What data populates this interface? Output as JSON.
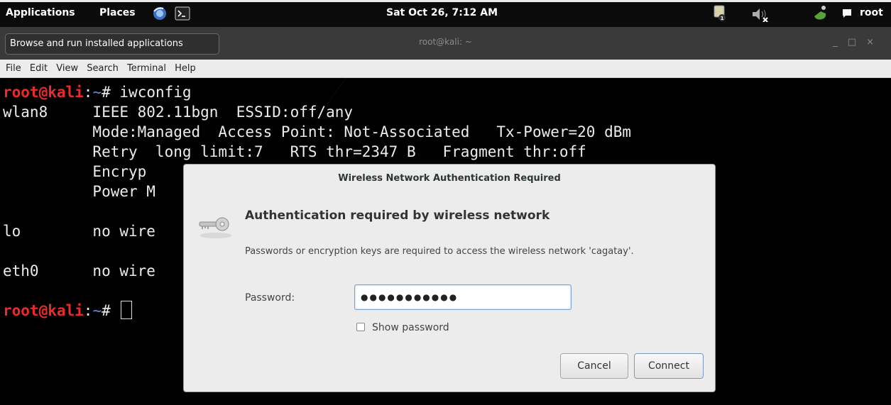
{
  "panel": {
    "applications": "Applications",
    "places": "Places",
    "clock": "Sat Oct 26,  7:12 AM",
    "user": "root"
  },
  "tooltip": {
    "text": "Browse and run installed applications"
  },
  "terminal": {
    "title": "root@kali: ~",
    "menu": [
      "File",
      "Edit",
      "View",
      "Search",
      "Terminal",
      "Help"
    ],
    "prompt_user": "root@kali",
    "prompt_sep": ":",
    "prompt_path": "~",
    "prompt_hash": "# ",
    "command": "iwconfig",
    "lines": [
      "wlan8     IEEE 802.11bgn  ESSID:off/any",
      "          Mode:Managed  Access Point: Not-Associated   Tx-Power=20 dBm",
      "          Retry  long limit:7   RTS thr=2347 B   Fragment thr:off",
      "          Encryp",
      "          Power M",
      "",
      "lo        no wire",
      "",
      "eth0      no wire",
      ""
    ]
  },
  "dialog": {
    "title": "Wireless Network Authentication Required",
    "heading": "Authentication required by wireless network",
    "description": "Passwords or encryption keys are required to access the wireless network 'cagatay'.",
    "password_label": "Password:",
    "password_value": "●●●●●●●●●●●",
    "show_password_label": "Show password",
    "show_password_checked": false,
    "cancel_label": "Cancel",
    "connect_label": "Connect"
  }
}
